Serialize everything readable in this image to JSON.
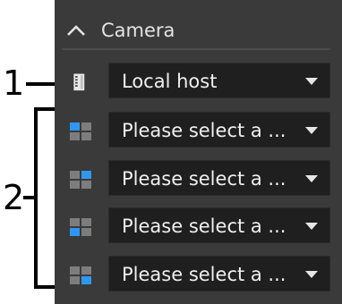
{
  "panel": {
    "title": "Camera",
    "colors": {
      "background": "#3a3a3a",
      "field": "#1f1f1f",
      "text": "#f0f0f0",
      "accent": "#2f97f2",
      "muted": "#7d7d7d"
    }
  },
  "host": {
    "icon": "server-icon",
    "value": "Local host"
  },
  "cameras": [
    {
      "icon": "grid-quadrant-1-icon",
      "active_quadrant": 0,
      "value": "Please select a ..."
    },
    {
      "icon": "grid-quadrant-2-icon",
      "active_quadrant": 1,
      "value": "Please select a ..."
    },
    {
      "icon": "grid-quadrant-3-icon",
      "active_quadrant": 2,
      "value": "Please select a ..."
    },
    {
      "icon": "grid-quadrant-4-icon",
      "active_quadrant": 3,
      "value": "Please select a ..."
    }
  ],
  "callouts": {
    "one": "1",
    "two": "2"
  }
}
